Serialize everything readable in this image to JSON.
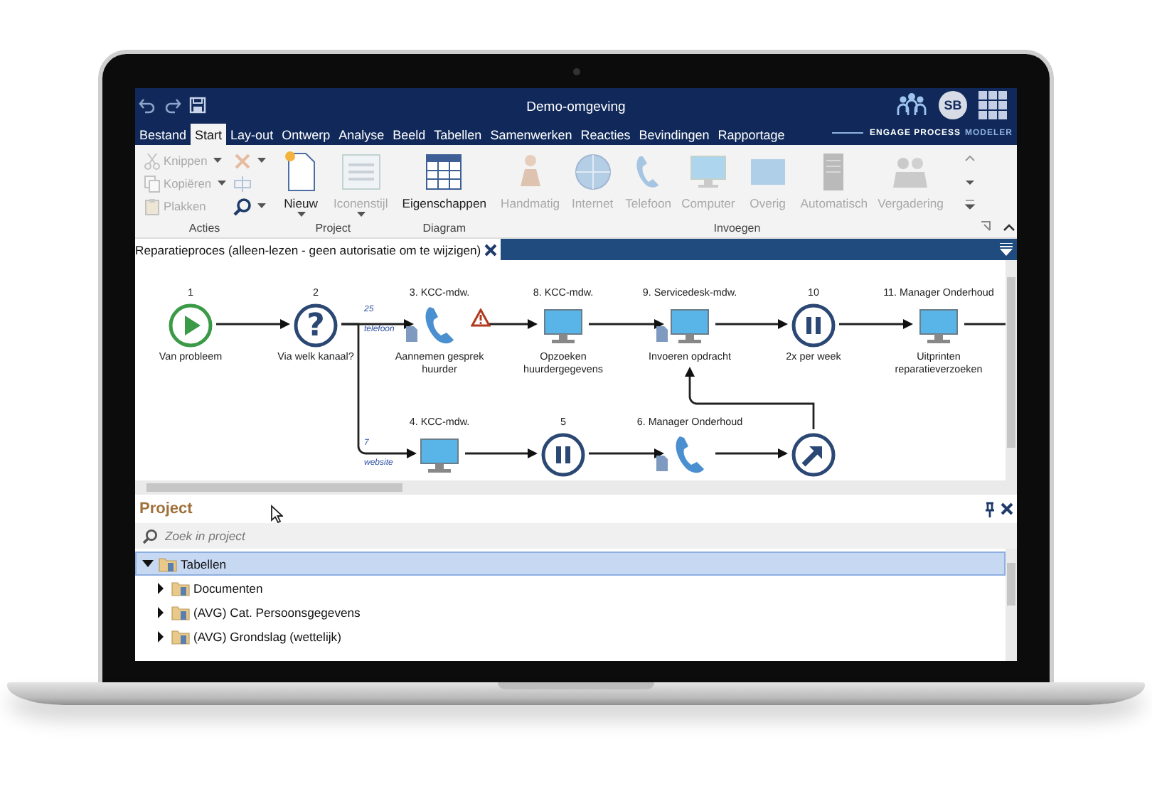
{
  "title_bar": {
    "title": "Demo-omgeving",
    "avatar": "SB"
  },
  "menu_tabs": [
    {
      "label": "Bestand",
      "selected": false
    },
    {
      "label": "Start",
      "selected": true
    },
    {
      "label": "Lay-out",
      "selected": false
    },
    {
      "label": "Ontwerp",
      "selected": false
    },
    {
      "label": "Analyse",
      "selected": false
    },
    {
      "label": "Beeld",
      "selected": false
    },
    {
      "label": "Tabellen",
      "selected": false
    },
    {
      "label": "Samenwerken",
      "selected": false
    },
    {
      "label": "Reacties",
      "selected": false
    },
    {
      "label": "Bevindingen",
      "selected": false
    },
    {
      "label": "Rapportage",
      "selected": false
    }
  ],
  "brand": {
    "main": "ENGAGE PROCESS",
    "sub": "MODELER"
  },
  "ribbon": {
    "groups": [
      {
        "title": "Acties",
        "items": [
          {
            "kind": "small",
            "label": "Knippen",
            "disabled": true,
            "dropdown": true
          },
          {
            "kind": "small",
            "label": "Kopiëren",
            "disabled": true,
            "dropdown": true
          },
          {
            "kind": "small",
            "label": "Plakken",
            "disabled": true,
            "dropdown": false
          },
          {
            "kind": "tool",
            "disabled": true,
            "dropdown": true
          },
          {
            "kind": "tool",
            "disabled": true,
            "dropdown": false
          },
          {
            "kind": "tool",
            "disabled": false,
            "dropdown": true
          }
        ]
      },
      {
        "title": "Project",
        "items": [
          {
            "kind": "large",
            "label": "Nieuw",
            "disabled": false,
            "dropdown": true
          },
          {
            "kind": "large",
            "label": "Iconenstijl",
            "disabled": true,
            "dropdown": true
          }
        ]
      },
      {
        "title": "Diagram",
        "items": [
          {
            "kind": "large",
            "label": "Eigenschappen",
            "disabled": false,
            "dropdown": false
          }
        ]
      },
      {
        "title": "Invoegen",
        "items": [
          {
            "kind": "large",
            "label": "Handmatig",
            "disabled": true,
            "dropdown": false
          },
          {
            "kind": "large",
            "label": "Internet",
            "disabled": true,
            "dropdown": false
          },
          {
            "kind": "large",
            "label": "Telefoon",
            "disabled": true,
            "dropdown": false
          },
          {
            "kind": "large",
            "label": "Computer",
            "disabled": true,
            "dropdown": false
          },
          {
            "kind": "large",
            "label": "Overig",
            "disabled": true,
            "dropdown": false
          },
          {
            "kind": "large",
            "label": "Automatisch",
            "disabled": true,
            "dropdown": false
          },
          {
            "kind": "large",
            "label": "Vergadering",
            "disabled": true,
            "dropdown": false
          }
        ]
      }
    ]
  },
  "document_tab": {
    "title": "Reparatieproces (alleen-lezen - geen autorisatie om te wijzigen)"
  },
  "diagram": {
    "nodes": [
      {
        "lane": "1",
        "kind": "start",
        "label": "Van probleem",
        "warning": false,
        "document": false
      },
      {
        "lane": "2",
        "kind": "decision",
        "symbol": "?",
        "label": "Via welk kanaal?",
        "warning": false,
        "document": false
      },
      {
        "lane": "3. KCC-mdw.",
        "kind": "phone",
        "label": "Aannemen gesprek huurder",
        "warning": true,
        "document": true
      },
      {
        "lane": "8. KCC-mdw.",
        "kind": "computer",
        "label": "Opzoeken huurdergegevens",
        "warning": false,
        "document": false
      },
      {
        "lane": "9. Servicedesk-mdw.",
        "kind": "computer",
        "label": "Invoeren opdracht",
        "warning": false,
        "document": true
      },
      {
        "lane": "10",
        "kind": "pause",
        "label": "2x per week",
        "warning": false,
        "document": false
      },
      {
        "lane": "11. Manager Onderhoud",
        "kind": "computer",
        "label": "Uitprinten reparatieverzoeken",
        "warning": false,
        "document": false
      },
      {
        "lane": "4. KCC-mdw.",
        "kind": "computer",
        "warning": false,
        "document": false
      },
      {
        "lane": "5",
        "kind": "pause",
        "warning": false,
        "document": false
      },
      {
        "lane": "6. Manager Onderhoud",
        "kind": "phone",
        "warning": false,
        "document": true
      },
      {
        "kind": "external",
        "warning": false,
        "document": false
      }
    ],
    "edge_labels": [
      {
        "count": "25",
        "channel": "telefoon"
      },
      {
        "count": "7",
        "channel": "website"
      }
    ]
  },
  "project_panel": {
    "title": "Project",
    "search": {
      "placeholder": "Zoek in project"
    },
    "tree": [
      {
        "label": "Tabellen",
        "expanded": true,
        "selected": true,
        "children": [
          {
            "label": "Documenten",
            "expanded": false,
            "selected": false
          },
          {
            "label": "(AVG) Cat. Persoonsgegevens",
            "expanded": false,
            "selected": false
          },
          {
            "label": "(AVG) Grondslag (wettelijk)",
            "expanded": false,
            "selected": false
          }
        ]
      }
    ]
  }
}
